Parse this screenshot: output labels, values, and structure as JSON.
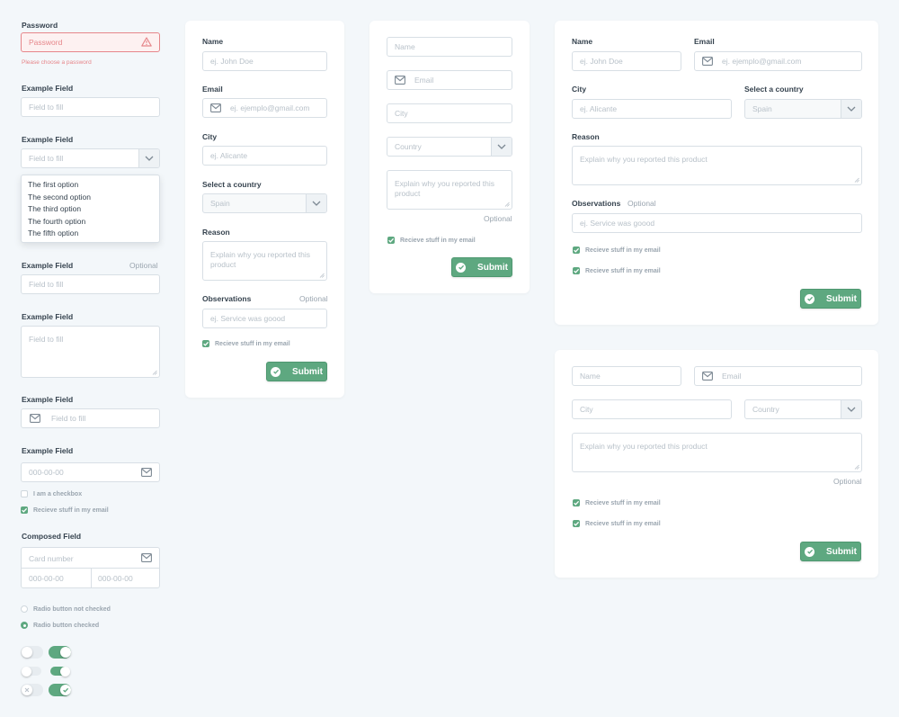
{
  "colors": {
    "accent": "#5ea880",
    "error": "#e6868a",
    "border": "#d8dfe5",
    "label": "#36434f",
    "placeholder": "#b8c1c9",
    "background": "#f3f7fa"
  },
  "icons": {
    "warning": "warning-triangle-icon",
    "mail": "mail-icon",
    "caret": "chevron-down-icon",
    "check": "check-icon",
    "submit": "check-circle-icon",
    "resize": "resize-grip-icon"
  },
  "col1": {
    "password": {
      "label": "Password",
      "placeholder": "Password",
      "error": "Please choose a password"
    },
    "field1": {
      "label": "Example Field",
      "placeholder": "Field to fill"
    },
    "select": {
      "label": "Example Field",
      "placeholder": "Field to fill",
      "options": [
        "The first option",
        "The second option",
        "The third option",
        "The fourth option",
        "The fifth option"
      ]
    },
    "optional_field": {
      "label": "Example Field",
      "optional": "Optional",
      "placeholder": "Field to fill"
    },
    "textarea": {
      "label": "Example Field",
      "placeholder": "Field to fill"
    },
    "icon_field": {
      "label": "Example Field",
      "placeholder": "Field to fill"
    },
    "date_field": {
      "label": "Example Field",
      "placeholder": "000-00-00"
    },
    "checkbox_unchecked": "I am a checkbox",
    "checkbox_checked": "Recieve stuff in my email",
    "composed": {
      "label": "Composed Field",
      "card": "Card number",
      "date1": "000-00-00",
      "date2": "000-00-00"
    },
    "radio_off": "Radio button not checked",
    "radio_on": "Radio button checked",
    "toggles": [
      {
        "on": false
      },
      {
        "on": true
      },
      {
        "on": false
      },
      {
        "on": true
      },
      {
        "on": false
      },
      {
        "on": true
      }
    ]
  },
  "form_a": {
    "name_label": "Name",
    "name_placeholder": "ej. John Doe",
    "email_label": "Email",
    "email_placeholder": "ej. ejemplo@gmail.com",
    "city_label": "City",
    "city_placeholder": "ej. Alicante",
    "country_label": "Select a country",
    "country_value": "Spain",
    "reason_label": "Reason",
    "reason_placeholder": "Explain why you reported this product",
    "obs_label": "Observations",
    "obs_optional": "Optional",
    "obs_placeholder": "ej. Service was goood",
    "check": "Recieve stuff in my email",
    "submit": "Submit"
  },
  "form_b": {
    "name": "Name",
    "email": "Email",
    "city": "City",
    "country": "Country",
    "reason": "Explain why you reported this product",
    "optional": "Optional",
    "check": "Recieve stuff in my email",
    "submit": "Submit"
  },
  "form_c": {
    "name_label": "Name",
    "name_placeholder": "ej. John Doe",
    "email_label": "Email",
    "email_placeholder": "ej. ejemplo@gmail.com",
    "city_label": "City",
    "city_placeholder": "ej. Alicante",
    "country_label": "Select a country",
    "country_value": "Spain",
    "reason_label": "Reason",
    "reason_placeholder": "Explain why you reported this product",
    "obs_label": "Observations",
    "obs_optional": "Optional",
    "obs_placeholder": "ej. Service was goood",
    "check1": "Recieve stuff in my email",
    "check2": "Recieve stuff in my email",
    "submit": "Submit"
  },
  "form_d": {
    "name": "Name",
    "email": "Email",
    "city": "City",
    "country": "Country",
    "reason": "Explain why you reported this product",
    "optional": "Optional",
    "check1": "Recieve stuff in my email",
    "check2": "Recieve stuff in my email",
    "submit": "Submit"
  }
}
